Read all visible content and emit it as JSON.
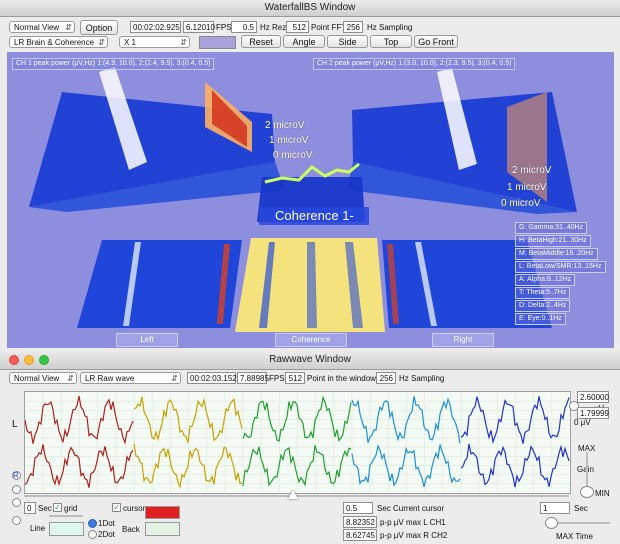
{
  "waterfall": {
    "title": "WaterfallBS Window",
    "view_select": "Normal View",
    "option_button": "Option",
    "time": "00:02:02.925",
    "fps_value": "6.12010",
    "fps_label": "FPS",
    "hz_rez_value": "0.5",
    "hz_rez_label": "Hz Rez",
    "point_fft_value": "512",
    "point_fft_label": "Point FFT",
    "sampling_value": "256",
    "sampling_label": "Hz Sampling",
    "montage_select": "LR Brain & Coherence",
    "scale_select": "X 1",
    "swatch_color": "#a8a2dc",
    "buttons": [
      "Reset",
      "Angle",
      "Side",
      "Top",
      "Go Front"
    ],
    "ch1_peak": "CH 1 peak power (μV,Hz) 1:(4.9, 10.0), 2:(2.4, 9.5), 3:(0.4, 0.5)",
    "ch2_peak": "CH 2 peak power (μV,Hz) 1:(3.0, 10.0), 2:(2.3, 9.5), 3:(0.4, 0.5)",
    "left_axis": [
      "2 microV",
      "1 microV",
      "0 microV"
    ],
    "right_axis": [
      "2 microV",
      "1 microV",
      "0 microV"
    ],
    "coherence_label": "Coherence 1-",
    "bands": [
      "G: Gamma:31..40Hz",
      "H: BetaHigh:21..30Hz",
      "M: BetaMiddle:16..20Hz",
      "L: BetaLow/SMR:13..15Hz",
      "A: Alpha:8..12Hz",
      "T: Theta:5..7Hz",
      "D: Delta:2..4Hz",
      "E: Eye:0..1Hz"
    ],
    "bottom_labels": {
      "left": "Left",
      "center": "Coherence",
      "right": "Right"
    },
    "bg_color": "#8e8ede"
  },
  "rawwave": {
    "title": "Rawwave Window",
    "view_select": "Normal View",
    "montage_select": "LR Raw wave",
    "time": "00:02:03.152",
    "fps_value": "7.88985",
    "fps_label": "FPS",
    "points_value": "512",
    "points_label": "Point in the window",
    "sampling_value": "256",
    "sampling_label": "Hz Sampling",
    "ch_left": "L",
    "ch_right": "R",
    "scale_value1": "2.60000",
    "scale_unit": "μV",
    "scale_value2": "1.79999",
    "zero_label": "0 μV",
    "max_label": "MAX",
    "gain_label": "Gain",
    "min_label": "MIN",
    "sec_value": "0",
    "sec_label": "Sec",
    "grid_label": "grid",
    "cursor_label": "cursor",
    "line_label": "Line",
    "back_label": "Back",
    "dot1_label": "1Dot",
    "dot2_label": "2Dot",
    "cursor_color": "#e02020",
    "back_color": "#e4f2e4",
    "line_color": "#dff6ef",
    "current_cursor_value": "0.5",
    "current_cursor_label": "Sec Current cursor",
    "pp_ch1_value": "8.82352",
    "pp_ch1_label": "p-p μV max L CH1",
    "pp_ch2_value": "8.62745",
    "pp_ch2_label": "p-p μV max R CH2",
    "maxtime_value": "1",
    "maxtime_sec": "Sec",
    "maxtime_label": "MAX Time",
    "segment_colors": [
      "#b02020",
      "#c8a000",
      "#22a030",
      "#1f8fd8",
      "#2233cc"
    ]
  }
}
